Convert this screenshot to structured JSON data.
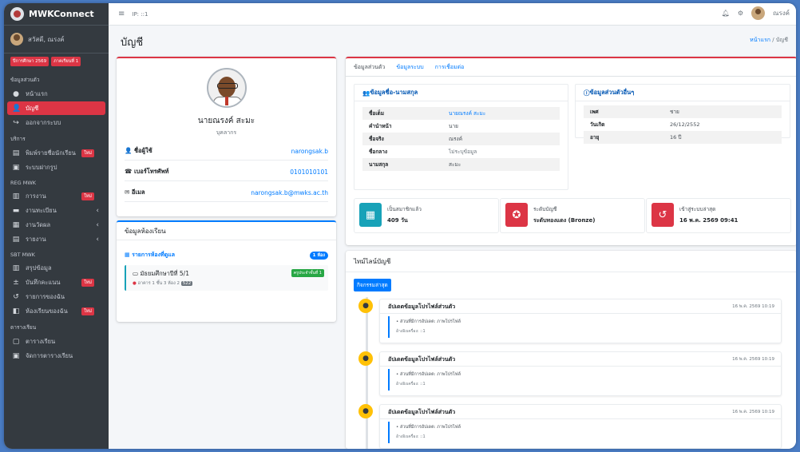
{
  "sidebar": {
    "brand": "MWKConnect",
    "user_name": "สวัสดี, ณรงค์",
    "badges": [
      "ปีการศึกษา 2569",
      "ภาคเรียนที่ 1"
    ],
    "sections": [
      {
        "header": "ข้อมูลส่วนตัว",
        "items": [
          {
            "label": "หน้าแรก",
            "icon": "gauge-icon"
          },
          {
            "label": "บัญชี",
            "icon": "user-icon",
            "active": true
          },
          {
            "label": "ออกจากระบบ",
            "icon": "logout-icon"
          }
        ]
      },
      {
        "header": "บริการ",
        "items": [
          {
            "label": "พิมพ์รายชื่อนักเรียน",
            "icon": "print-icon",
            "new": "ใหม่"
          },
          {
            "label": "ระบบฝากรูป",
            "icon": "image-icon"
          }
        ]
      },
      {
        "header": "REG MWK",
        "items": [
          {
            "label": "การงาน",
            "icon": "chart-icon",
            "new": "ใหม่"
          },
          {
            "label": "งานทะเบียน",
            "icon": "folder-icon",
            "chevron": true
          },
          {
            "label": "งานวัดผล",
            "icon": "doc-icon",
            "chevron": true
          },
          {
            "label": "รายงาน",
            "icon": "print-icon",
            "chevron": true
          }
        ]
      },
      {
        "header": "SBT MWK",
        "items": [
          {
            "label": "สรุปข้อมูล",
            "icon": "chart-icon"
          },
          {
            "label": "บันทึกคะแนน",
            "icon": "plusminus-icon",
            "new": "ใหม่"
          },
          {
            "label": "รายการของฉัน",
            "icon": "history-icon"
          },
          {
            "label": "ห้องเรียนของฉัน",
            "icon": "classroom-icon",
            "new": "ใหม่"
          }
        ]
      },
      {
        "header": "ตารางเรียน",
        "items": [
          {
            "label": "ตารางเรียน",
            "icon": "calendar-icon"
          },
          {
            "label": "จัดการตารางเรียน",
            "icon": "calendar-icon"
          }
        ]
      }
    ]
  },
  "topbar": {
    "ip": "IP: ::1",
    "user": "ณรงค์"
  },
  "page": {
    "title": "บัญชี",
    "crumb_home": "หน้าแรก",
    "crumb_sep": "/",
    "crumb_current": "บัญชี"
  },
  "profile": {
    "name": "นายณรงค์ สะมะ",
    "role": "บุคลากร",
    "rows": [
      {
        "key": "ชื่อผู้ใช้",
        "value": "narongsak.b",
        "icon": "user-icon"
      },
      {
        "key": "เบอร์โทรศัพท์",
        "value": "0101010101",
        "icon": "phone-icon"
      },
      {
        "key": "อีเมล",
        "value": "narongsak.b@mwks.ac.th",
        "icon": "mail-icon"
      }
    ]
  },
  "classroom": {
    "title": "ข้อมูลห้องเรียน",
    "subtitle": "รายการห้องที่ดูแล",
    "count": "1 ห้อง",
    "room_name": "มัธยมศึกษาปีที่ 5/1",
    "room_location": "อาคาร 1 ชั้น 3 ห้อง 2",
    "room_code": "522",
    "room_badge": "ครูประจำชั้นที่ 1"
  },
  "info": {
    "tabs": [
      "ข้อมูลส่วนตัว",
      "ข้อมูลระบบ",
      "การเชื่อมต่อ"
    ],
    "name_section": {
      "title": "ข้อมูลชื่อ-นามสกุล",
      "rows": [
        {
          "key": "ชื่อเต็ม",
          "value": "นายณรงค์ สะมะ"
        },
        {
          "key": "คำนำหน้า",
          "value": "นาย"
        },
        {
          "key": "ชื่อจริง",
          "value": "ณรงค์"
        },
        {
          "key": "ชื่อกลาง",
          "value": "ไม่ระบุข้อมูล"
        },
        {
          "key": "นามสกุล",
          "value": "สะมะ"
        }
      ]
    },
    "other_section": {
      "title": "ข้อมูลส่วนตัวอื่นๆ",
      "rows": [
        {
          "key": "เพศ",
          "value": "ชาย"
        },
        {
          "key": "วันเกิด",
          "value": "26/12/2552"
        },
        {
          "key": "อายุ",
          "value": "16 ปี"
        }
      ]
    },
    "stats": [
      {
        "label": "เป็นสมาชิกแล้ว",
        "value": "409 วัน",
        "color": "#17a2b8",
        "icon": "calendar-icon"
      },
      {
        "label": "ระดับบัญชี",
        "value": "ระดับทองแดง (Bronze)",
        "color": "#dc3545",
        "icon": "award-icon"
      },
      {
        "label": "เข้าสู่ระบบล่าสุด",
        "value": "16 พ.ค. 2569 09:41",
        "color": "#dc3545",
        "icon": "history-icon"
      }
    ]
  },
  "timeline": {
    "title": "ไทม์ไลน์บัญชี",
    "label": "กิจกรรมล่าสุด",
    "items": [
      {
        "title": "อัปเดตข้อมูลโปรไฟล์ส่วนตัว",
        "time": "16 พ.ค. 2569 10:19",
        "detail": "ส่วนที่มีการอัปเดต: ภาพโปรไฟล์",
        "ip": "อ้างอิงเครื่อง: ::1"
      },
      {
        "title": "อัปเดตข้อมูลโปรไฟล์ส่วนตัว",
        "time": "16 พ.ค. 2569 10:19",
        "detail": "ส่วนที่มีการอัปเดต: ภาพโปรไฟล์",
        "ip": "อ้างอิงเครื่อง: ::1"
      },
      {
        "title": "อัปเดตข้อมูลโปรไฟล์ส่วนตัว",
        "time": "16 พ.ค. 2569 10:19",
        "detail": "ส่วนที่มีการอัปเดต: ภาพโปรไฟล์",
        "ip": "อ้างอิงเครื่อง: ::1"
      }
    ]
  }
}
